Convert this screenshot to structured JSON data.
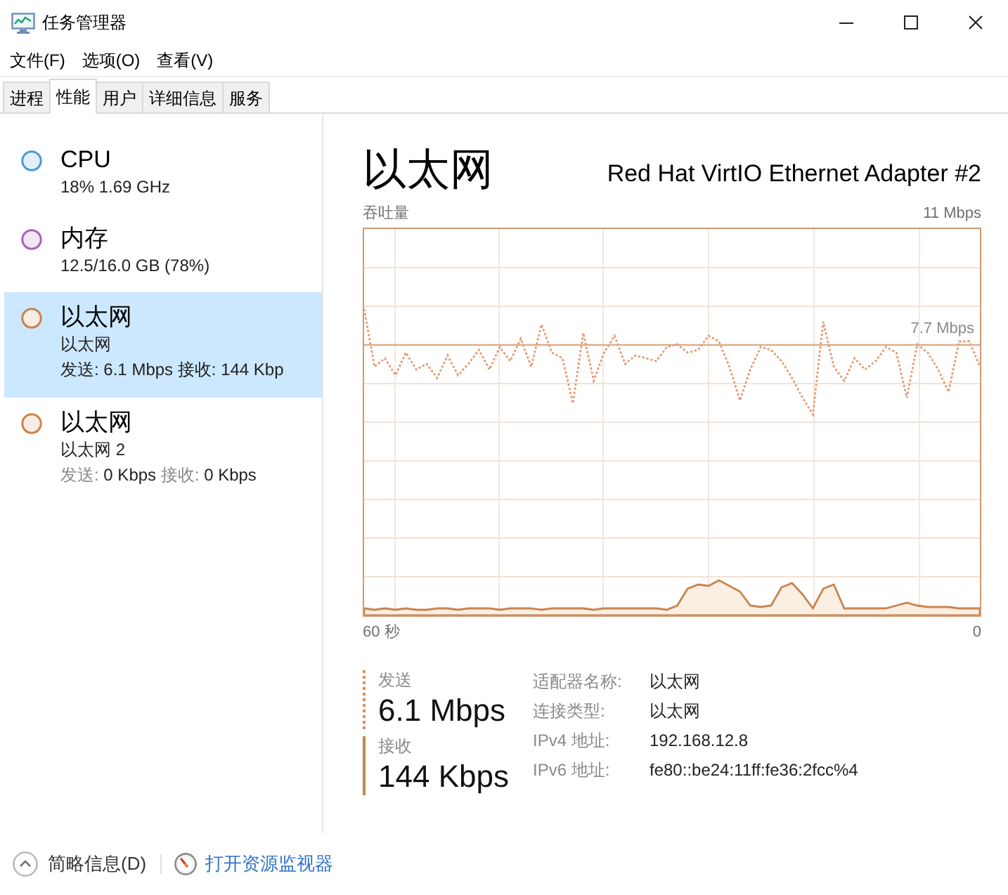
{
  "window": {
    "title": "任务管理器"
  },
  "menu": [
    "文件(F)",
    "选项(O)",
    "查看(V)"
  ],
  "tabs": [
    {
      "label": "进程",
      "selected": false
    },
    {
      "label": "性能",
      "selected": true
    },
    {
      "label": "用户",
      "selected": false
    },
    {
      "label": "详细信息",
      "selected": false
    },
    {
      "label": "服务",
      "selected": false
    }
  ],
  "sidebar": {
    "items": [
      {
        "title": "CPU",
        "detail": "18% 1.69 GHz",
        "color": "#4a9bd6",
        "selected": false
      },
      {
        "title": "内存",
        "detail": "12.5/16.0 GB (78%)",
        "color": "#b05cc8",
        "selected": false
      },
      {
        "title": "以太网",
        "detail": "以太网",
        "stats": [
          {
            "label": "发送:",
            "value": "6.1 Mbps"
          },
          {
            "label": "接收:",
            "value": "144 Kbp"
          }
        ],
        "color": "#c8844c",
        "selected": true
      },
      {
        "title": "以太网",
        "detail": "以太网 2",
        "stats": [
          {
            "label": "发送:",
            "value": "0 Kbps"
          },
          {
            "label": "接收:",
            "value": "0 Kbps"
          }
        ],
        "color": "#c8844c",
        "selected": false
      }
    ]
  },
  "panel": {
    "title": "以太网",
    "adapter": "Red Hat VirtIO Ethernet Adapter #2",
    "graph": {
      "label": "吞吐量",
      "max": "11 Mbps",
      "marker": "7.7 Mbps",
      "x_start": "60 秒",
      "x_end": "0"
    },
    "rates": [
      {
        "kind": "send",
        "label": "发送",
        "value": "6.1 Mbps"
      },
      {
        "kind": "receive",
        "label": "接收",
        "value": "144 Kbps"
      }
    ],
    "details": [
      {
        "label": "适配器名称:",
        "value": "以太网"
      },
      {
        "label": "连接类型:",
        "value": "以太网"
      },
      {
        "label": "IPv4 地址:",
        "value": "192.168.12.8"
      },
      {
        "label": "IPv6 地址:",
        "value": "fe80::be24:11ff:fe36:2fcc%4"
      }
    ]
  },
  "footer": {
    "toggle": "简略信息(D)",
    "link": "打开资源监视器"
  }
}
